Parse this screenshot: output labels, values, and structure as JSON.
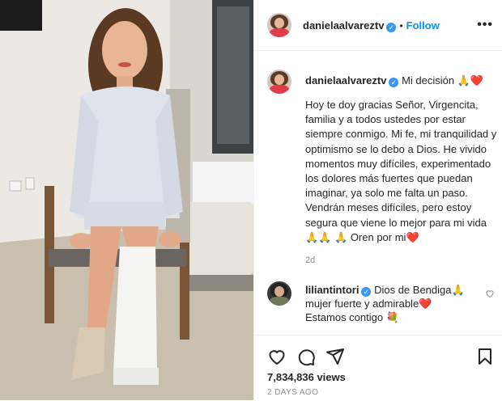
{
  "post": {
    "username": "danielaalvareztv",
    "follow_label": "Follow",
    "caption_title": "Mi decisión",
    "caption_body": "Hoy te doy gracias Señor, Virgencita, familia y a todos ustedes por estar siempre conmigo. Mi fe, mi tranquilidad y optimismo se lo debo a Dios. He vivido momentos muy difíciles, experimentado los dolores más fuertes que puedan imaginar, ya solo me falta un paso. Vendrán meses difíciles, pero estoy segura que viene lo mejor para mi vida",
    "caption_end": "Oren por mi",
    "caption_age": "2d",
    "views": "7,834,836 views",
    "posted": "2 DAYS AGO"
  },
  "comment": {
    "username": "liliantintori",
    "text_a": "Dios de Bendiga",
    "text_b": "mujer fuerte y admirable",
    "text_c": "Estamos contigo"
  },
  "emoji": {
    "pray": "🙏",
    "heart": "❤️",
    "bouquet": "💐"
  },
  "colors": {
    "accent": "#0095f6",
    "verified": "#3897f0",
    "heart": "#ed1c24"
  }
}
